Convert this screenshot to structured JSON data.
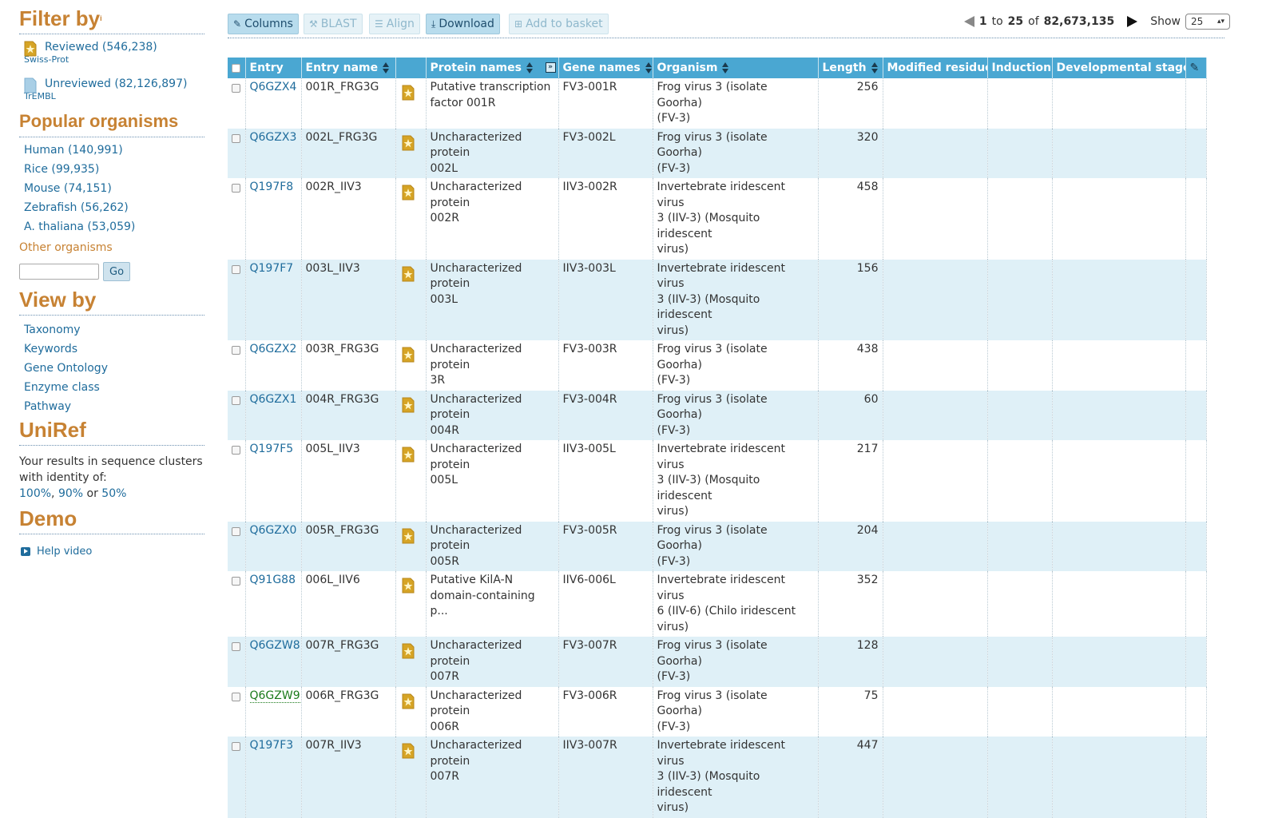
{
  "sidebar": {
    "filter_heading": "Filter by",
    "filter_sup": "i",
    "reviewed": {
      "label": "Reviewed (546,238)",
      "sub": "Swiss-Prot"
    },
    "unreviewed": {
      "label": "Unreviewed (82,126,897)",
      "sub": "TrEMBL"
    },
    "popular_heading": "Popular organisms",
    "organisms": [
      "Human (140,991)",
      "Rice (99,935)",
      "Mouse (74,151)",
      "Zebrafish (56,262)",
      "A. thaliana (53,059)"
    ],
    "other_organisms": "Other organisms",
    "organism_input_value": "",
    "go_label": "Go",
    "view_heading": "View by",
    "view_items": [
      "Taxonomy",
      "Keywords",
      "Gene Ontology",
      "Enzyme class",
      "Pathway"
    ],
    "uniref_heading": "UniRef",
    "uniref_text1": "Your results in sequence clusters",
    "uniref_text2": "with identity of:",
    "uniref_100": "100%",
    "uniref_90": "90%",
    "uniref_or": "or",
    "uniref_50": "50%",
    "demo_heading": "Demo",
    "help_video": "Help video"
  },
  "toolbar": {
    "columns": "Columns",
    "blast": "BLAST",
    "align": "Align",
    "download": "Download",
    "basket": "Add to basket"
  },
  "pager": {
    "start": "1",
    "to": "to",
    "end": "25",
    "of": "of",
    "total": "82,673,135",
    "show_label": "Show",
    "show_value": "25"
  },
  "table": {
    "headers": {
      "entry": "Entry",
      "entry_name": "Entry name",
      "protein_names": "Protein names",
      "gene_names": "Gene names",
      "organism": "Organism",
      "length": "Length",
      "modified_residue": "Modified residue",
      "induction": "Induction",
      "developmental_stage": "Developmental stage"
    },
    "rows": [
      {
        "entry": "Q6GZX4",
        "entry_name": "001R_FRG3G",
        "protein": [
          "Putative transcription",
          "factor 001R"
        ],
        "gene": "FV3-001R",
        "organism": [
          "Frog virus 3 (isolate Goorha)",
          "(FV-3)"
        ],
        "length": "256"
      },
      {
        "entry": "Q6GZX3",
        "entry_name": "002L_FRG3G",
        "protein": [
          "Uncharacterized protein",
          "002L"
        ],
        "gene": "FV3-002L",
        "organism": [
          "Frog virus 3 (isolate Goorha)",
          "(FV-3)"
        ],
        "length": "320"
      },
      {
        "entry": "Q197F8",
        "entry_name": "002R_IIV3",
        "protein": [
          "Uncharacterized protein",
          "002R"
        ],
        "gene": "IIV3-002R",
        "organism": [
          "Invertebrate iridescent virus",
          "3 (IIV-3) (Mosquito iridescent",
          "virus)"
        ],
        "length": "458"
      },
      {
        "entry": "Q197F7",
        "entry_name": "003L_IIV3",
        "protein": [
          "Uncharacterized protein",
          "003L"
        ],
        "gene": "IIV3-003L",
        "organism": [
          "Invertebrate iridescent virus",
          "3 (IIV-3) (Mosquito iridescent",
          "virus)"
        ],
        "length": "156"
      },
      {
        "entry": "Q6GZX2",
        "entry_name": "003R_FRG3G",
        "protein": [
          "Uncharacterized protein",
          "3R"
        ],
        "gene": "FV3-003R",
        "organism": [
          "Frog virus 3 (isolate Goorha)",
          "(FV-3)"
        ],
        "length": "438"
      },
      {
        "entry": "Q6GZX1",
        "entry_name": "004R_FRG3G",
        "protein": [
          "Uncharacterized protein",
          "004R"
        ],
        "gene": "FV3-004R",
        "organism": [
          "Frog virus 3 (isolate Goorha)",
          "(FV-3)"
        ],
        "length": "60"
      },
      {
        "entry": "Q197F5",
        "entry_name": "005L_IIV3",
        "protein": [
          "Uncharacterized protein",
          "005L"
        ],
        "gene": "IIV3-005L",
        "organism": [
          "Invertebrate iridescent virus",
          "3 (IIV-3) (Mosquito iridescent",
          "virus)"
        ],
        "length": "217"
      },
      {
        "entry": "Q6GZX0",
        "entry_name": "005R_FRG3G",
        "protein": [
          "Uncharacterized protein",
          "005R"
        ],
        "gene": "FV3-005R",
        "organism": [
          "Frog virus 3 (isolate Goorha)",
          "(FV-3)"
        ],
        "length": "204"
      },
      {
        "entry": "Q91G88",
        "entry_name": "006L_IIV6",
        "protein": [
          "Putative KilA-N",
          "domain-containing p..."
        ],
        "gene": "IIV6-006L",
        "organism": [
          "Invertebrate iridescent virus",
          "6 (IIV-6) (Chilo iridescent",
          "virus)"
        ],
        "length": "352"
      },
      {
        "entry": "Q6GZW8",
        "entry_name": "007R_FRG3G",
        "protein": [
          "Uncharacterized protein",
          "007R"
        ],
        "gene": "FV3-007R",
        "organism": [
          "Frog virus 3 (isolate Goorha)",
          "(FV-3)"
        ],
        "length": "128"
      },
      {
        "entry": "Q6GZW9",
        "entry_name": "006R_FRG3G",
        "protein": [
          "Uncharacterized protein",
          "006R"
        ],
        "gene": "FV3-006R",
        "organism": [
          "Frog virus 3 (isolate Goorha)",
          "(FV-3)"
        ],
        "length": "75",
        "visited": true
      },
      {
        "entry": "Q197F3",
        "entry_name": "007R_IIV3",
        "protein": [
          "Uncharacterized protein",
          "007R"
        ],
        "gene": "IIV3-007R",
        "organism": [
          "Invertebrate iridescent virus",
          "3 (IIV-3) (Mosquito iridescent",
          "virus)"
        ],
        "length": "447"
      }
    ]
  },
  "colors": {
    "accent_orange": "#c78233",
    "header_blue": "#4aa7d2",
    "link_blue": "#1f6c9c",
    "row_alt": "#dff0f7"
  },
  "icons": {
    "reviewed": "reviewed-star-doc-icon",
    "unreviewed": "unreviewed-doc-icon",
    "columns": "pencil-icon",
    "blast": "wrench-icon",
    "align": "align-lines-icon",
    "download": "download-icon",
    "basket": "basket-icon"
  }
}
